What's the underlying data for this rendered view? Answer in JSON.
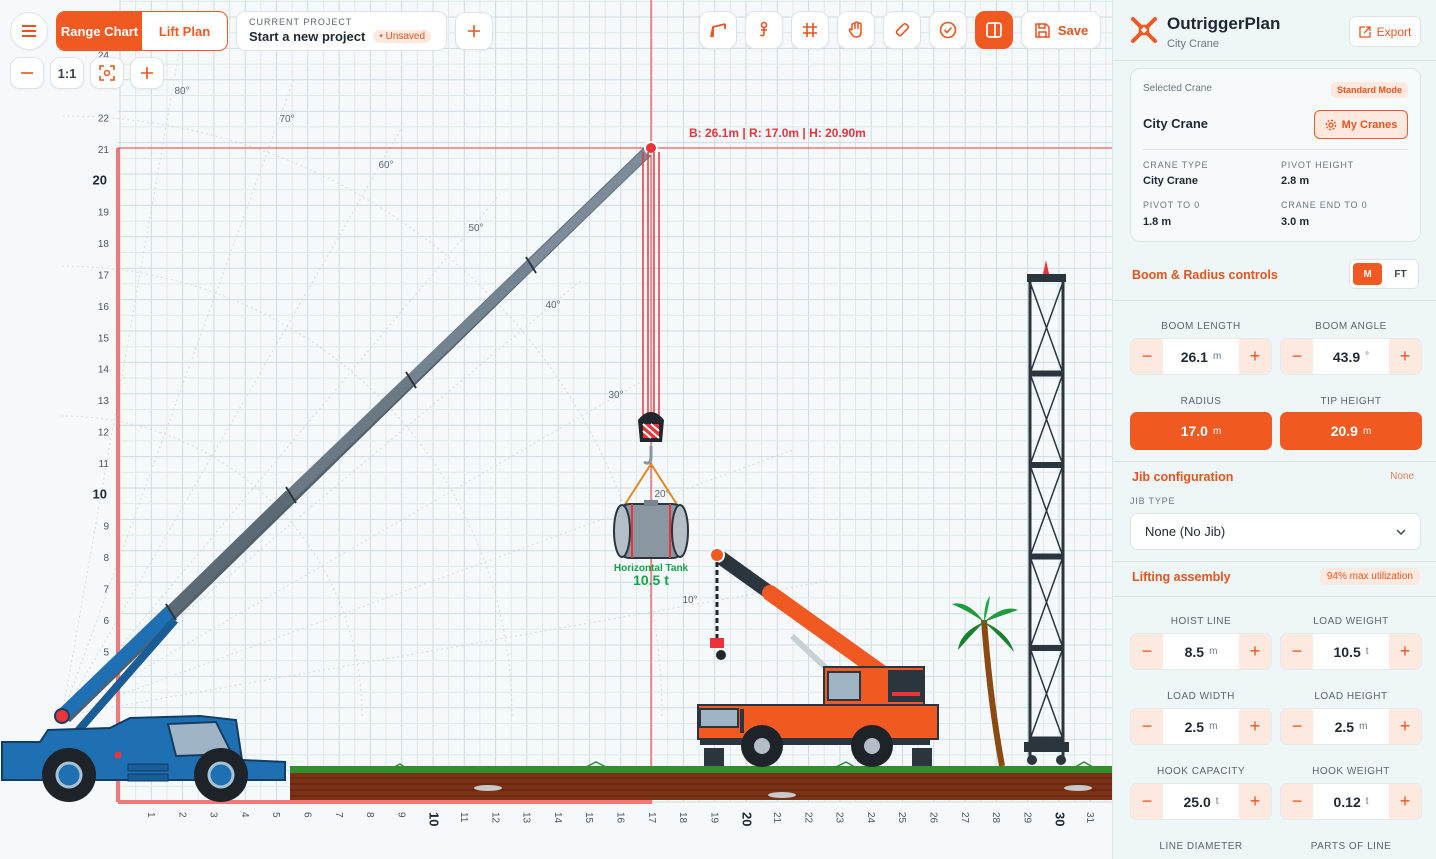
{
  "toolbar": {
    "mode_tabs": [
      "Range Chart",
      "Lift Plan"
    ],
    "project_caption": "CURRENT PROJECT",
    "project_name": "Start a new project",
    "unsaved_badge": "• Unsaved",
    "save_label": "Save",
    "zoom_label": "1:1"
  },
  "measurement": "B: 26.1m | R: 17.0m | H: 20.90m",
  "load": {
    "name": "Horizontal Tank",
    "weight": "10.5 t"
  },
  "axes": {
    "y_ticks": [
      "5",
      "6",
      "7",
      "8",
      "9",
      "10",
      "11",
      "12",
      "13",
      "14",
      "15",
      "16",
      "17",
      "18",
      "19",
      "20",
      "21",
      "22",
      "24"
    ],
    "x_ticks": [
      "1",
      "2",
      "3",
      "4",
      "5",
      "6",
      "7",
      "8",
      "9",
      "10",
      "11",
      "12",
      "13",
      "14",
      "15",
      "16",
      "17",
      "18",
      "19",
      "20",
      "21",
      "22",
      "23",
      "24",
      "25",
      "26",
      "27",
      "28",
      "29",
      "30",
      "31"
    ],
    "angle_labels": [
      "80°",
      "70°",
      "60°",
      "50°",
      "40°",
      "30°",
      "20°",
      "10°"
    ]
  },
  "sidebar": {
    "app_title": "OutriggerPlan",
    "app_subtitle": "City Crane",
    "export_label": "Export",
    "selected_crane_caption": "Selected Crane",
    "mode_badge": "Standard Mode",
    "crane_name": "City Crane",
    "my_cranes_label": "My Cranes",
    "specs": [
      {
        "label": "CRANE TYPE",
        "value": "City Crane"
      },
      {
        "label": "PIVOT HEIGHT",
        "value": "2.8 m"
      },
      {
        "label": "PIVOT TO 0",
        "value": "1.8 m"
      },
      {
        "label": "CRANE END TO 0",
        "value": "3.0 m"
      }
    ],
    "boom_section": "Boom & Radius controls",
    "units": [
      "M",
      "FT"
    ],
    "boom_length": {
      "label": "BOOM LENGTH",
      "value": "26.1",
      "unit": "m"
    },
    "boom_angle": {
      "label": "BOOM ANGLE",
      "value": "43.9",
      "unit": "°"
    },
    "radius": {
      "label": "RADIUS",
      "value": "17.0",
      "unit": "m"
    },
    "tip_height": {
      "label": "TIP HEIGHT",
      "value": "20.9",
      "unit": "m"
    },
    "jib_section": "Jib configuration",
    "jib_badge": "None",
    "jib_type_label": "JIB TYPE",
    "jib_type_value": "None (No Jib)",
    "lifting_section": "Lifting assembly",
    "utilization_badge": "94% max utilization",
    "hoist_line": {
      "label": "HOIST LINE",
      "value": "8.5",
      "unit": "m"
    },
    "load_weight": {
      "label": "LOAD WEIGHT",
      "value": "10.5",
      "unit": "t"
    },
    "load_width": {
      "label": "LOAD WIDTH",
      "value": "2.5",
      "unit": "m"
    },
    "load_height": {
      "label": "LOAD HEIGHT",
      "value": "2.5",
      "unit": "m"
    },
    "hook_capacity": {
      "label": "HOOK CAPACITY",
      "value": "25.0",
      "unit": "t"
    },
    "hook_weight": {
      "label": "HOOK WEIGHT",
      "value": "0.12",
      "unit": "t"
    },
    "line_diameter_label": "LINE DIAMETER",
    "parts_of_line_label": "PARTS OF LINE"
  },
  "colors": {
    "accent": "#f05a22",
    "accent_soft": "#fde9df",
    "crane_blue": "#1f6fb3",
    "range_red": "#f0797a"
  }
}
